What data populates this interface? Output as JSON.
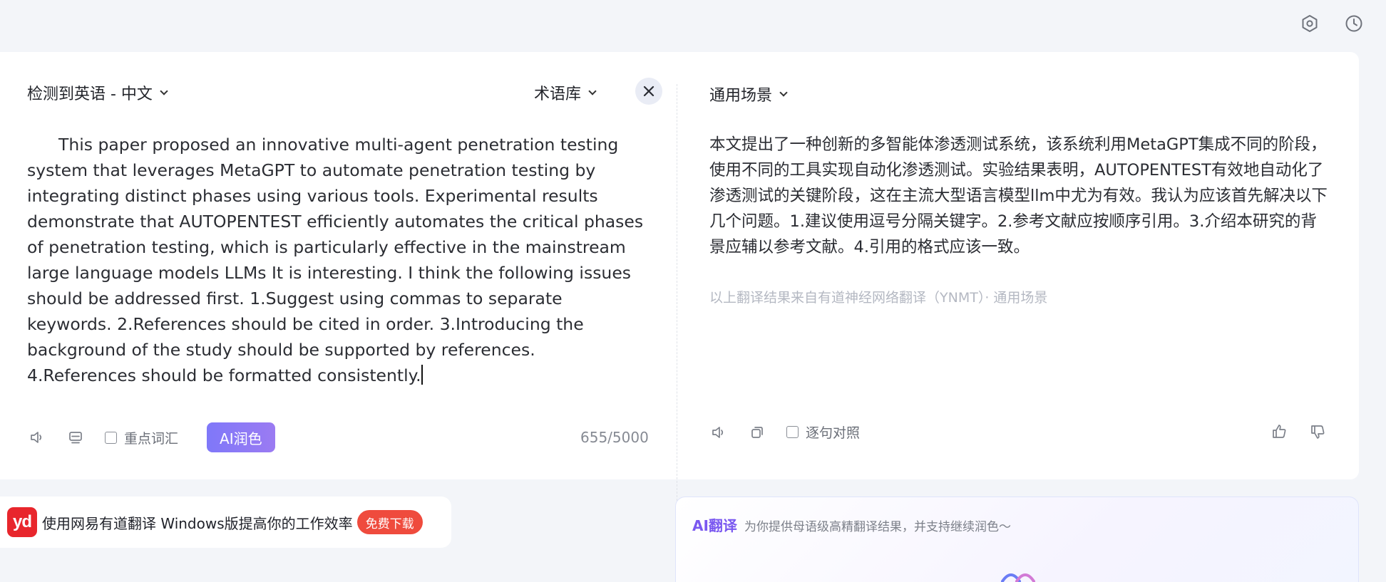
{
  "source": {
    "language_label": "检测到英语 - 中文",
    "glossary_label": "术语库",
    "text": "This paper proposed an innovative multi-agent penetration testing system that leverages MetaGPT to automate penetration testing by integrating distinct phases using various tools. Experimental results demonstrate that AUTOPENTEST efficiently automates the critical phases of penetration testing, which is particularly effective in the mainstream large language models LLMs It is interesting. I think the following issues should be addressed first. 1.Suggest using commas to separate keywords. 2.References should be cited in order. 3.Introducing the background of the study should be supported by references. 4.References should be formatted consistently.",
    "keyword_label": "重点词汇",
    "ai_polish_label": "AI润色",
    "char_count": "655/5000"
  },
  "target": {
    "scenario_label": "通用场景",
    "text": "本文提出了一种创新的多智能体渗透测试系统，该系统利用MetaGPT集成不同的阶段，使用不同的工具实现自动化渗透测试。实验结果表明，AUTOPENTEST有效地自动化了渗透测试的关键阶段，这在主流大型语言模型llm中尤为有效。我认为应该首先解决以下几个问题。1.建议使用逗号分隔关键字。2.参考文献应按顺序引用。3.介绍本研究的背景应辅以参考文献。4.引用的格式应该一致。",
    "source_note": "以上翻译结果来自有道神经网络翻译（YNMT）· 通用场景",
    "compare_label": "逐句对照"
  },
  "promo": {
    "logo_text": "yd",
    "text": "使用网易有道翻译 Windows版提高你的工作效率",
    "button_label": "免费下载"
  },
  "ai_card": {
    "title": "AI翻译",
    "subtitle": "为你提供母语级高精翻译结果，并支持继续润色～"
  },
  "icons": [
    "settings-icon",
    "history-icon",
    "close-icon",
    "speaker-icon",
    "layout-icon",
    "copy-icon",
    "thumbs-up-icon",
    "thumbs-down-icon"
  ],
  "colors": {
    "accent": "#7f78f9",
    "brand_red": "#e8262c",
    "promo_button": "#ef4b3d",
    "ai_title": "#7a58f0"
  }
}
